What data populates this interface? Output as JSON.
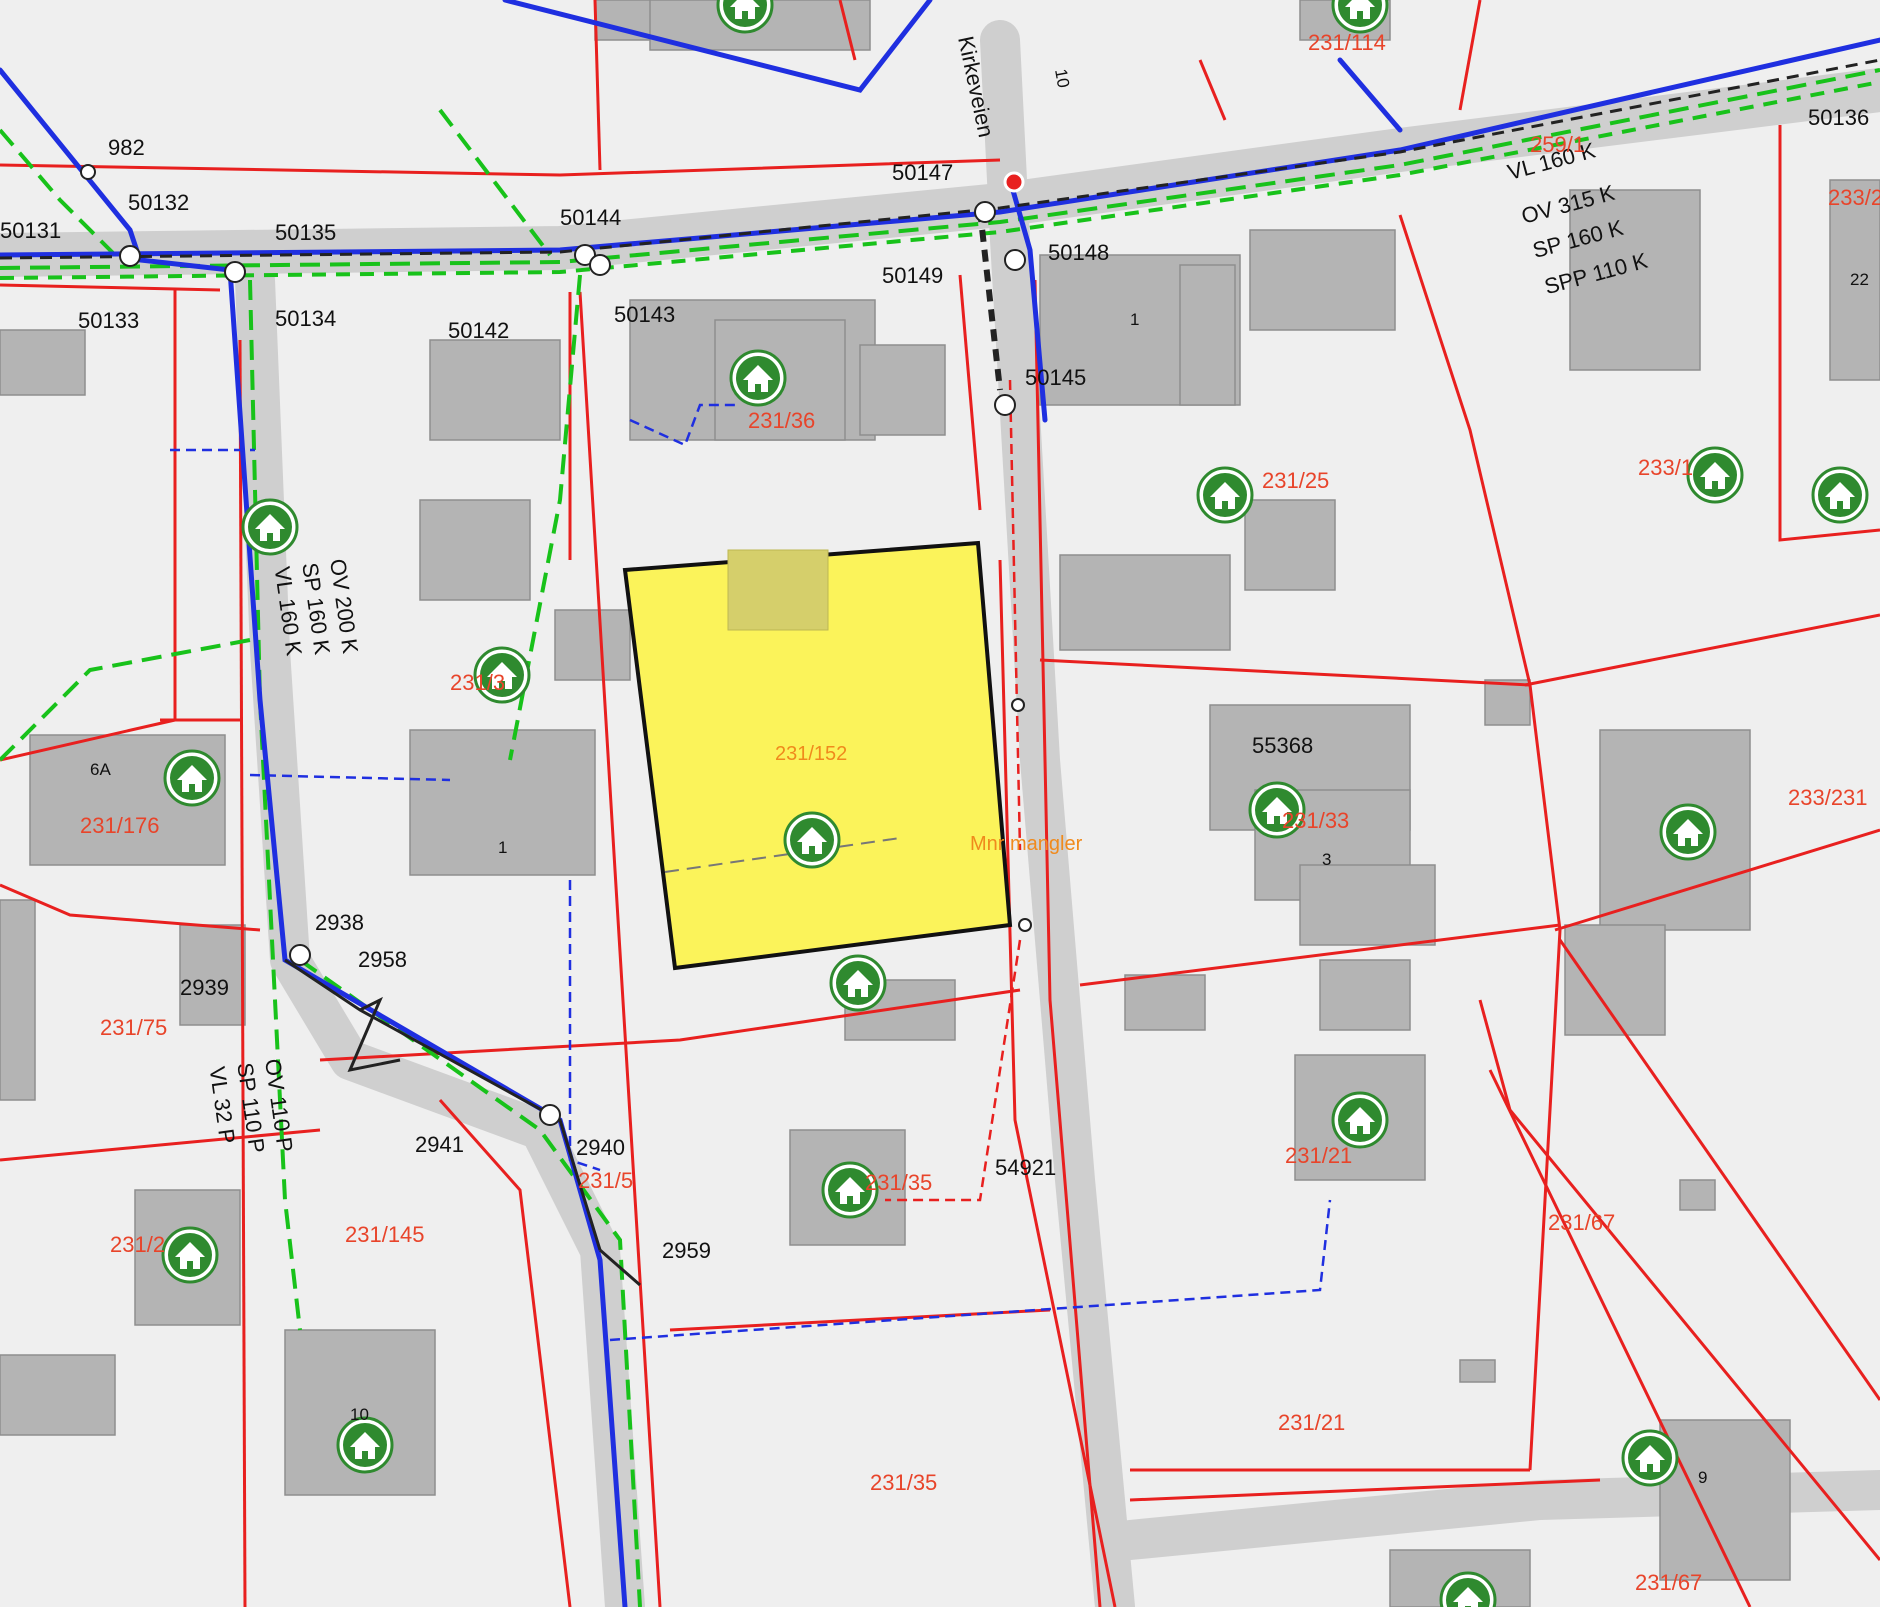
{
  "map": {
    "colors": {
      "background": "#efefef",
      "road": "#cfcfcf",
      "building": "#b4b4b4",
      "parcel_line": "#e8201f",
      "water_line": "#1f2fe0",
      "sewer_line": "#18c21a",
      "drain_line": "#222222",
      "highlight_fill": "#fbf35a",
      "icon_green": "#2f8a2f"
    },
    "selected_parcel": {
      "label": "231/152",
      "note": "Mnr mangler"
    },
    "street_name": "Kirkeveien",
    "pipe_annotations": {
      "main_road": [
        "VL 160 K",
        "OV 315 K",
        "SP 160 K",
        "SPP 110 K"
      ],
      "west_road": [
        "OV 200 K",
        "SP 160 K",
        "VL 160 K"
      ],
      "southwest_road": [
        "OV 110 P",
        "SP 110 P",
        "VL 32 P"
      ],
      "top_right": "259/1"
    },
    "node_labels": [
      "982",
      "50132",
      "50131",
      "50135",
      "50133",
      "50134",
      "50144",
      "50142",
      "50143",
      "50147",
      "50149",
      "50148",
      "50145",
      "50136",
      "2938",
      "2958",
      "2939",
      "2941",
      "2940",
      "2959",
      "54921",
      "55368"
    ],
    "parcel_labels": [
      "231/114",
      "231/36",
      "231/25",
      "233/1",
      "233/2",
      "231/176",
      "231/75",
      "231/145",
      "231/5",
      "231/2",
      "231/35",
      "231/35",
      "231/33",
      "231/21",
      "231/21",
      "231/67",
      "231/67",
      "233/231",
      "231/3"
    ],
    "house_numbers": [
      "1",
      "1",
      "3",
      "6A",
      "10",
      "9",
      "22",
      "10"
    ]
  }
}
